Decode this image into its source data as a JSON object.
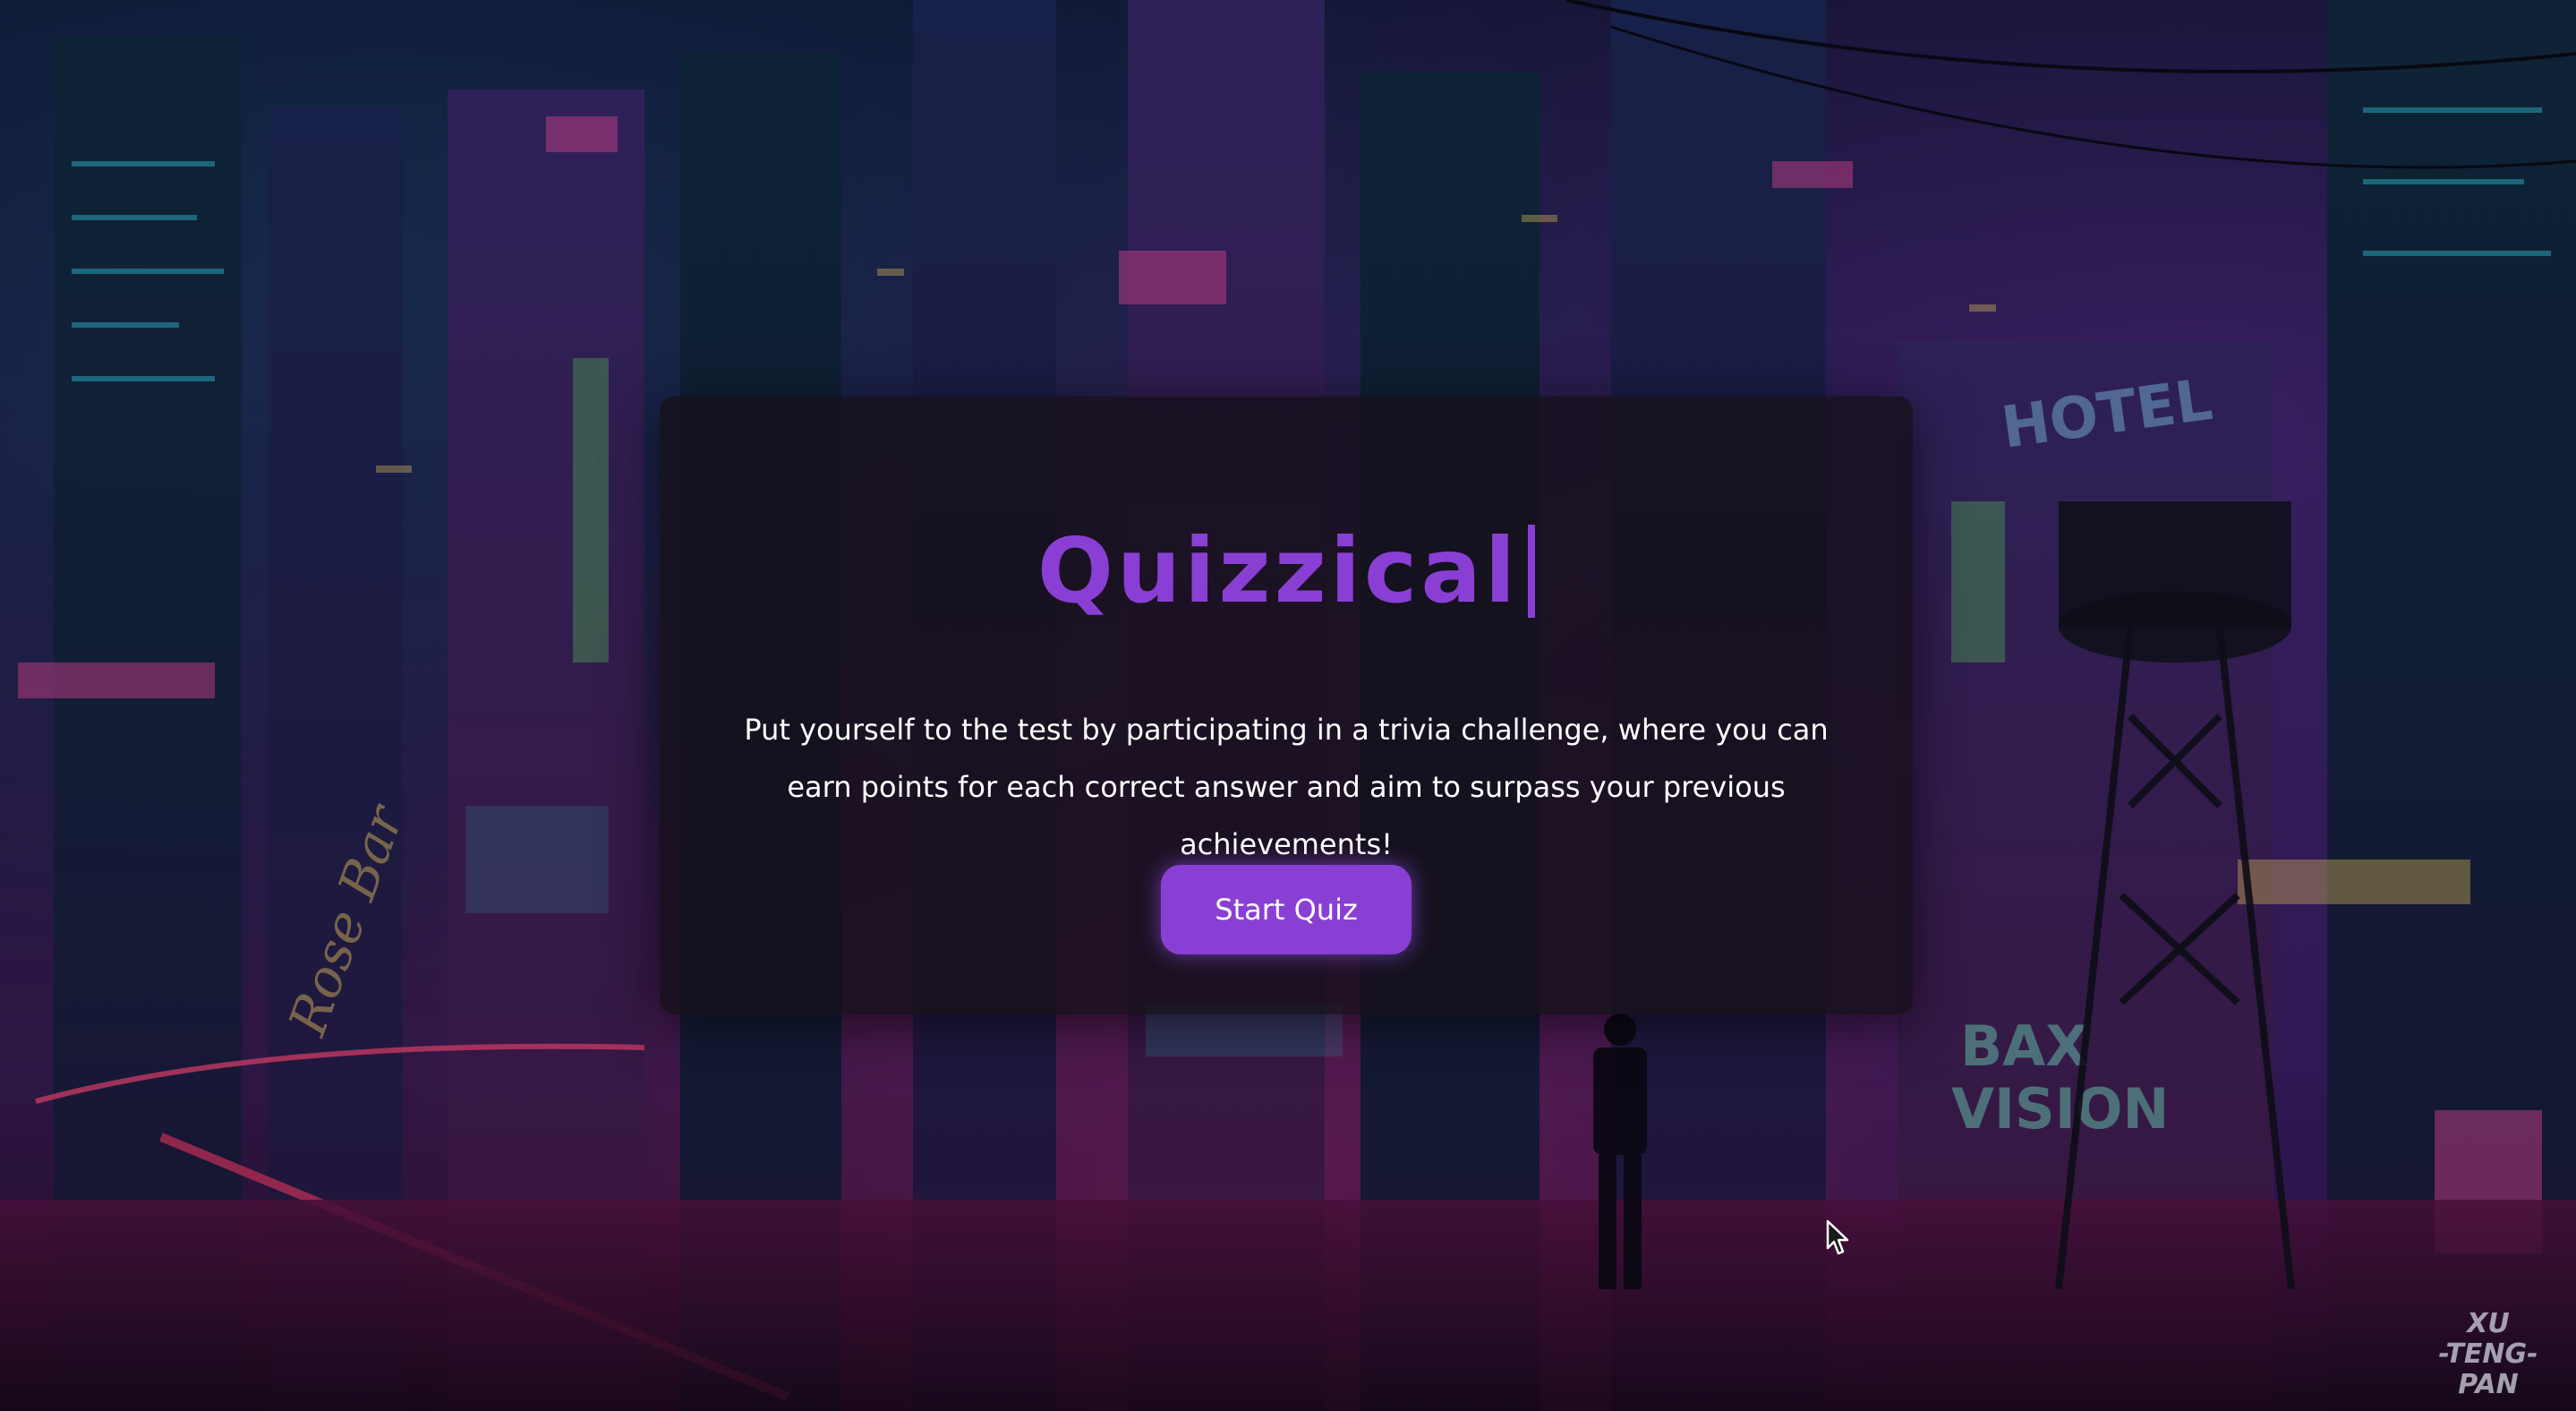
{
  "app": {
    "title": "Quizzical",
    "tagline": "Put yourself to the test by participating in a trivia challenge, where you can earn points for each correct answer and aim to surpass your previous achievements!",
    "start_label": "Start Quiz"
  },
  "background": {
    "watermark": [
      "XU",
      "-TENG-",
      "PAN"
    ],
    "scene_signs": [
      "HOTEL",
      "BAX VISION",
      "Rose Bar"
    ]
  },
  "colors": {
    "accent": "#8a3fd4",
    "card": "rgba(22,16,26,0.82)",
    "text": "#ffffff"
  }
}
